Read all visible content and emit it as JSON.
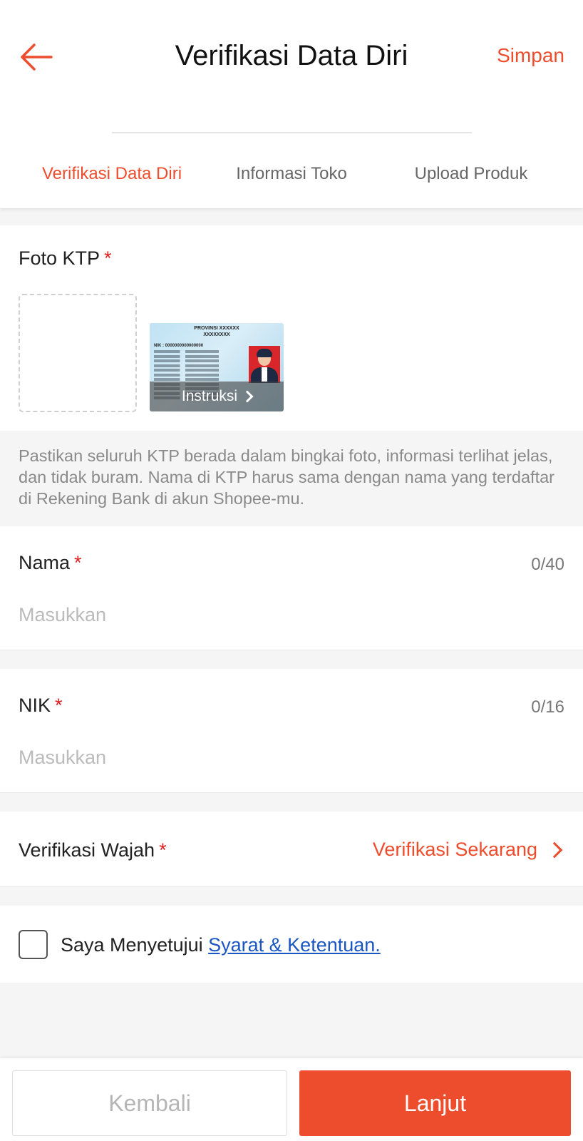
{
  "header": {
    "title": "Verifikasi Data Diri",
    "save_label": "Simpan",
    "back_icon": "arrow-left-icon"
  },
  "steps": [
    {
      "label": "Verifikasi Data Diri",
      "active": true
    },
    {
      "label": "Informasi Toko",
      "active": false
    },
    {
      "label": "Upload Produk",
      "active": false
    }
  ],
  "ktp": {
    "label": "Foto KTP",
    "required_mark": "*",
    "sample_province": "PROVINSI XXXXXX",
    "sample_city": "XXXXXXXX",
    "sample_nik": "NIK : 0000000000000000",
    "instruction_label": "Instruksi",
    "hint": "Pastikan seluruh KTP berada dalam bingkai foto, informasi terlihat jelas, dan tidak buram. Nama di KTP harus sama dengan nama yang terdaftar di Rekening Bank di akun Shopee-mu."
  },
  "nama": {
    "label": "Nama",
    "required_mark": "*",
    "counter": "0/40",
    "value": "",
    "placeholder": "Masukkan"
  },
  "nik": {
    "label": "NIK",
    "required_mark": "*",
    "counter": "0/16",
    "value": "",
    "placeholder": "Masukkan"
  },
  "wajah": {
    "label": "Verifikasi Wajah",
    "required_mark": "*",
    "action_label": "Verifikasi Sekarang"
  },
  "agreement": {
    "text": "Saya Menyetujui ",
    "link_label": "Syarat & Ketentuan.",
    "checked": false
  },
  "footer": {
    "back_label": "Kembali",
    "next_label": "Lanjut"
  },
  "colors": {
    "accent": "#ee4d2d",
    "link": "#1a55c4",
    "required": "#e02020"
  }
}
